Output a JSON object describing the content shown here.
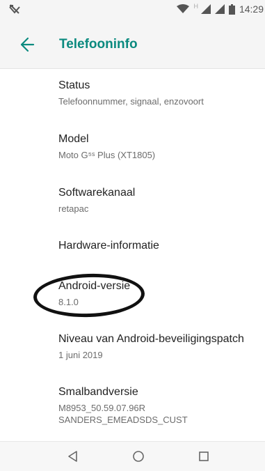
{
  "status_bar": {
    "left_icon": "wifi-off-icon",
    "network_label": "H",
    "time": "14:29",
    "icons": [
      "wifi-icon",
      "signal-icon",
      "signal-icon",
      "battery-icon"
    ]
  },
  "app_bar": {
    "back_icon": "arrow-left-icon",
    "title": "Telefooninfo",
    "accent_color": "#0b8a7f"
  },
  "items": [
    {
      "title": "Status",
      "subtitle": "Telefoonnummer, signaal, enzovoort"
    },
    {
      "title": "Model",
      "subtitle": "Moto G⁵ˢ Plus (XT1805)"
    },
    {
      "title": "Softwarekanaal",
      "subtitle": "retapac"
    },
    {
      "title": "Hardware-informatie",
      "subtitle": ""
    },
    {
      "title": "Android-versie",
      "subtitle": "8.1.0"
    },
    {
      "title": "Niveau van Android-beveiligingspatch",
      "subtitle": "1 juni 2019"
    },
    {
      "title": "Smalbandversie",
      "subtitle": "M8953_50.59.07.96R",
      "subtitle2": "SANDERS_EMEADSDS_CUST"
    }
  ],
  "nav_bar": {
    "icons": [
      "back-triangle-icon",
      "home-circle-icon",
      "recents-square-icon"
    ]
  }
}
